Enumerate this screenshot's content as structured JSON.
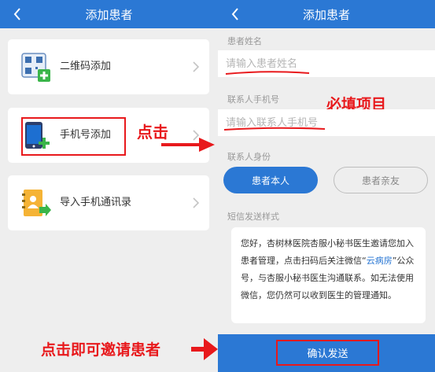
{
  "left": {
    "title": "添加患者",
    "options": [
      {
        "label": "二维码添加",
        "icon": "qr-code-icon"
      },
      {
        "label": "手机号添加",
        "icon": "phone-add-icon"
      },
      {
        "label": "导入手机通讯录",
        "icon": "contacts-import-icon"
      }
    ],
    "annotation_click": "点击"
  },
  "right": {
    "title": "添加患者",
    "name_label": "患者姓名",
    "name_placeholder": "请输入患者姓名",
    "phone_label": "联系人手机号",
    "phone_placeholder": "请输入联系人手机号",
    "required_annotation": "必填项目",
    "identity_label": "联系人身份",
    "identity_options": [
      "患者本人",
      "患者亲友"
    ],
    "identity_selected": "患者本人",
    "sms_label": "短信发送样式",
    "sms_text_before": "您好，杏树林医院杏服小秘书医生邀请您加入患者管理，点击扫码后关注微信“",
    "sms_link": "云病房",
    "sms_text_after": "”公众号，与杏服小秘书医生沟通联系。如无法使用微信，您仍然可以收到医生的管理通知。",
    "confirm_label": "确认发送"
  },
  "bottom_annotation": "点击即可邀请患者",
  "colors": {
    "brand_blue": "#2b78d4",
    "annotation_red": "#e8191c",
    "background": "#eeeeee"
  }
}
